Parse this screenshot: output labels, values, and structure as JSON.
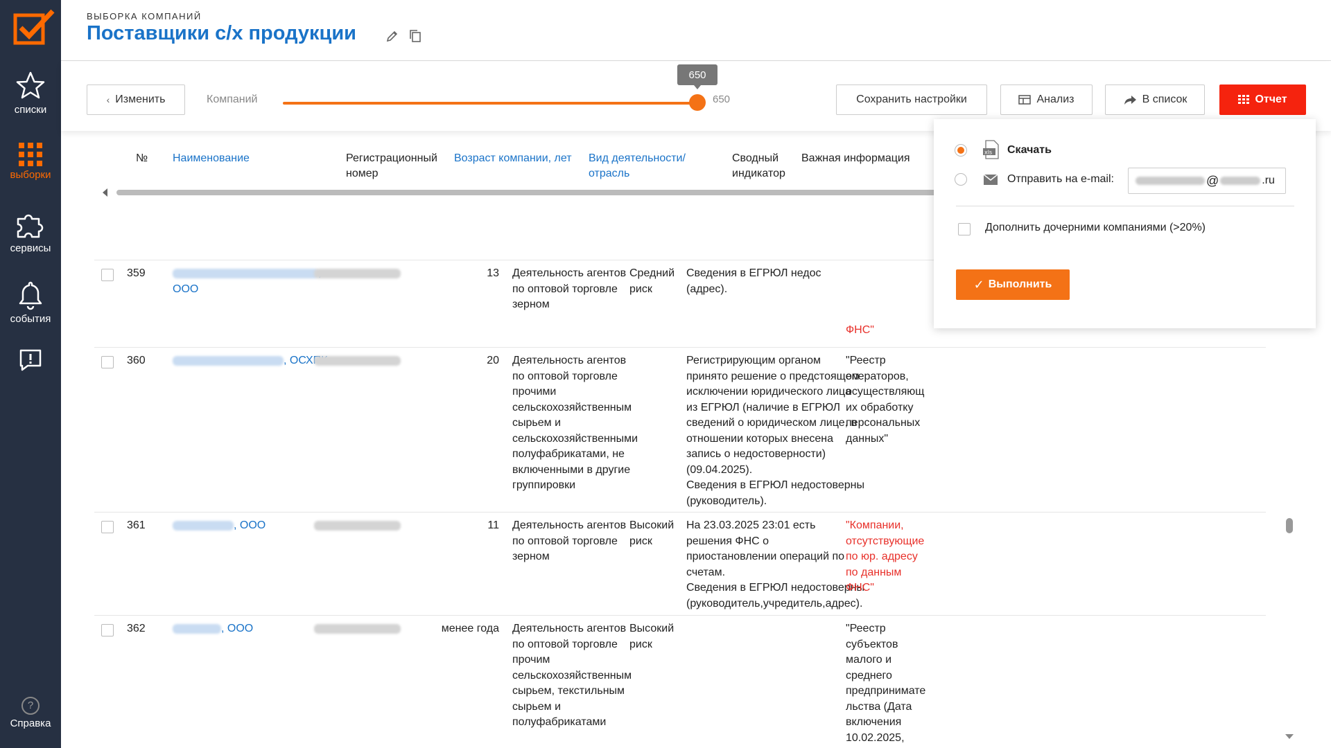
{
  "sidebar": {
    "items": [
      {
        "label": "списки",
        "icon": "star-icon"
      },
      {
        "label": "выборки",
        "icon": "grid-icon"
      },
      {
        "label": "сервисы",
        "icon": "puzzle-icon"
      },
      {
        "label": "события",
        "icon": "bell-icon"
      },
      {
        "label": "",
        "icon": "feedback-icon"
      }
    ],
    "help_label": "Справка",
    "help_icon_glyph": "?"
  },
  "header": {
    "eyebrow": "ВЫБОРКА КОМПАНИЙ",
    "title": "Поставщики с/х продукции"
  },
  "toolbar": {
    "edit_label": "Изменить",
    "slider_label": "Компаний",
    "slider_value": "650",
    "slider_max": "650",
    "save_settings_label": "Сохранить настройки",
    "analysis_label": "Анализ",
    "to_list_label": "В список",
    "report_label": "Отчет"
  },
  "table": {
    "headers": {
      "num": "№",
      "name": "Наименование",
      "reg_line1": "Регистрационный",
      "reg_line2": "номер",
      "age": "Возраст компании, лет",
      "act_line1": "Вид деятельности/",
      "act_line2": "отрасль",
      "ind_line1": "Сводный",
      "ind_line2": "индикатор",
      "info": "Важная информация"
    },
    "rows": [
      {
        "num": "359",
        "name_suffix": ",",
        "name_line2": "ООО",
        "age": "13",
        "activity": [
          "Деятельность агентов",
          "по оптовой торговле",
          "зерном"
        ],
        "indicator": [
          "Средний",
          "риск"
        ],
        "info": [
          "Сведения в ЕГРЮЛ недос",
          "(адрес)."
        ],
        "risk": [
          "ФНС\""
        ]
      },
      {
        "num": "360",
        "name_suffix": ", ОСХПК",
        "age": "20",
        "activity": [
          "Деятельность агентов",
          "по оптовой торговле",
          "прочими",
          "сельскохозяйственным",
          "сырьем и",
          "сельскохозяйственными",
          "полуфабрикатами, не",
          "включенными в другие",
          "группировки"
        ],
        "indicator": [],
        "info": [
          "Регистрирующим органом",
          "принято решение о предстоящем",
          "исключении юридического лица",
          "из ЕГРЮЛ (наличие в ЕГРЮЛ",
          "сведений о юридическом лице, в",
          "отношении которых внесена",
          "запись о недостоверности)",
          "(09.04.2025).",
          "Сведения в ЕГРЮЛ недостоверны",
          "(руководитель)."
        ],
        "risk": [
          "\"Реестр",
          "операторов,",
          "осуществляющ",
          "их обработку",
          "персональных",
          "данных\""
        ]
      },
      {
        "num": "361",
        "name_suffix": ", ООО",
        "age": "11",
        "activity": [
          "Деятельность агентов",
          "по оптовой торговле",
          "зерном"
        ],
        "indicator": [
          "Высокий",
          "риск"
        ],
        "info": [
          "На 23.03.2025 23:01 есть",
          "решения ФНС о",
          "приостановлении операций по",
          "счетам.",
          "Сведения в ЕГРЮЛ недостоверны",
          "(руководитель,учредитель,адрес)."
        ],
        "risk": [
          "\"Компании,",
          "отсутствующие",
          "по юр. адресу",
          "по данным",
          "ФНС\""
        ]
      },
      {
        "num": "362",
        "name_suffix": ", ООО",
        "age": "менее года",
        "activity": [
          "Деятельность агентов",
          "по оптовой торговле",
          "прочим",
          "сельскохозяйственным",
          "сырьем, текстильным",
          "сырьем и",
          "полуфабрикатами"
        ],
        "indicator": [
          "Высокий",
          "риск"
        ],
        "info": [],
        "risk": [
          "\"Реестр",
          "субъектов",
          "малого и",
          "среднего",
          "предпринимате",
          "льства (Дата",
          "включения",
          "10.02.2025,"
        ]
      }
    ]
  },
  "report_dropdown": {
    "download_label": "Скачать",
    "email_label": "Отправить на e-mail:",
    "email_at": "@",
    "email_tld": ".ru",
    "subsidiaries_label": "Дополнить дочерними компаниями (>20%)",
    "execute_label": "Выполнить",
    "execute_glyph": "✓"
  },
  "colors": {
    "accent_orange": "#f47216",
    "report_red": "#f5230e",
    "link_blue": "#1a73c8",
    "sidebar_bg": "#263042",
    "risk_red": "#e8302a"
  }
}
